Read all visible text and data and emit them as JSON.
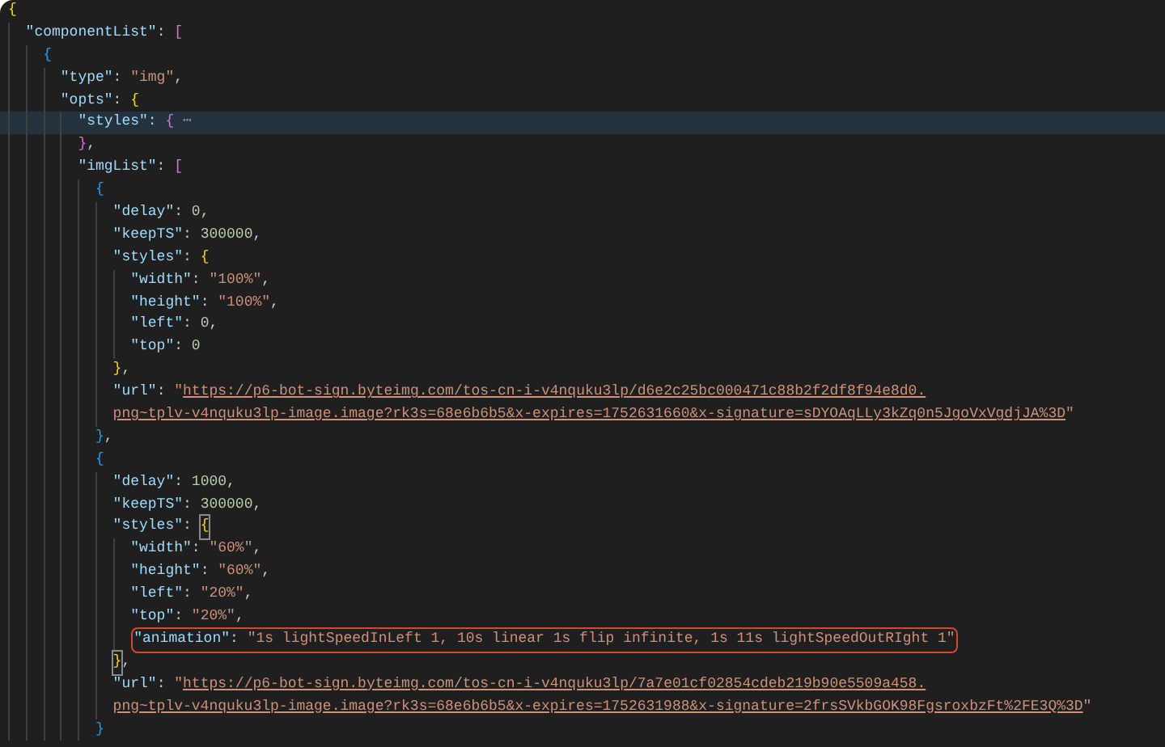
{
  "editor": {
    "lines": [
      {
        "tokens": [
          {
            "kind": "bracket",
            "text": "{",
            "color": "#ffd700"
          }
        ],
        "children": [
          {
            "tokens": [
              {
                "kind": "key",
                "text": "\"componentList\""
              },
              {
                "kind": "punct",
                "text": ": "
              },
              {
                "kind": "bracket",
                "text": "[",
                "color": "#da70d6"
              }
            ],
            "children": [
              {
                "tokens": [
                  {
                    "kind": "bracket",
                    "text": "{",
                    "color": "#179fff"
                  }
                ],
                "children": [
                  {
                    "tokens": [
                      {
                        "kind": "key",
                        "text": "\"type\""
                      },
                      {
                        "kind": "punct",
                        "text": ": "
                      },
                      {
                        "kind": "string",
                        "text": "\"img\""
                      },
                      {
                        "kind": "punct",
                        "text": ","
                      }
                    ]
                  },
                  {
                    "tokens": [
                      {
                        "kind": "key",
                        "text": "\"opts\""
                      },
                      {
                        "kind": "punct",
                        "text": ": "
                      },
                      {
                        "kind": "bracket",
                        "text": "{",
                        "color": "#ffd700"
                      }
                    ],
                    "children": [
                      {
                        "highlighted": true,
                        "tokens": [
                          {
                            "kind": "key",
                            "text": "\"styles\""
                          },
                          {
                            "kind": "punct",
                            "text": ": "
                          },
                          {
                            "kind": "bracket",
                            "text": "{",
                            "color": "#da70d6"
                          },
                          {
                            "kind": "fold",
                            "text": " ⋯"
                          }
                        ]
                      },
                      {
                        "tokens": [
                          {
                            "kind": "bracket",
                            "text": "}",
                            "color": "#da70d6"
                          },
                          {
                            "kind": "punct",
                            "text": ","
                          }
                        ]
                      },
                      {
                        "tokens": [
                          {
                            "kind": "key",
                            "text": "\"imgList\""
                          },
                          {
                            "kind": "punct",
                            "text": ": "
                          },
                          {
                            "kind": "bracket",
                            "text": "[",
                            "color": "#da70d6"
                          }
                        ],
                        "children": [
                          {
                            "tokens": [
                              {
                                "kind": "bracket",
                                "text": "{",
                                "color": "#179fff"
                              }
                            ],
                            "children": [
                              {
                                "tokens": [
                                  {
                                    "kind": "key",
                                    "text": "\"delay\""
                                  },
                                  {
                                    "kind": "punct",
                                    "text": ": "
                                  },
                                  {
                                    "kind": "number",
                                    "text": "0"
                                  },
                                  {
                                    "kind": "punct",
                                    "text": ","
                                  }
                                ]
                              },
                              {
                                "tokens": [
                                  {
                                    "kind": "key",
                                    "text": "\"keepTS\""
                                  },
                                  {
                                    "kind": "punct",
                                    "text": ": "
                                  },
                                  {
                                    "kind": "number",
                                    "text": "300000"
                                  },
                                  {
                                    "kind": "punct",
                                    "text": ","
                                  }
                                ]
                              },
                              {
                                "tokens": [
                                  {
                                    "kind": "key",
                                    "text": "\"styles\""
                                  },
                                  {
                                    "kind": "punct",
                                    "text": ": "
                                  },
                                  {
                                    "kind": "bracket",
                                    "text": "{",
                                    "color": "#ffd700"
                                  }
                                ],
                                "children": [
                                  {
                                    "tokens": [
                                      {
                                        "kind": "key",
                                        "text": "\"width\""
                                      },
                                      {
                                        "kind": "punct",
                                        "text": ": "
                                      },
                                      {
                                        "kind": "string",
                                        "text": "\"100%\""
                                      },
                                      {
                                        "kind": "punct",
                                        "text": ","
                                      }
                                    ]
                                  },
                                  {
                                    "tokens": [
                                      {
                                        "kind": "key",
                                        "text": "\"height\""
                                      },
                                      {
                                        "kind": "punct",
                                        "text": ": "
                                      },
                                      {
                                        "kind": "string",
                                        "text": "\"100%\""
                                      },
                                      {
                                        "kind": "punct",
                                        "text": ","
                                      }
                                    ]
                                  },
                                  {
                                    "tokens": [
                                      {
                                        "kind": "key",
                                        "text": "\"left\""
                                      },
                                      {
                                        "kind": "punct",
                                        "text": ": "
                                      },
                                      {
                                        "kind": "number",
                                        "text": "0"
                                      },
                                      {
                                        "kind": "punct",
                                        "text": ","
                                      }
                                    ]
                                  },
                                  {
                                    "tokens": [
                                      {
                                        "kind": "key",
                                        "text": "\"top\""
                                      },
                                      {
                                        "kind": "punct",
                                        "text": ": "
                                      },
                                      {
                                        "kind": "number",
                                        "text": "0"
                                      }
                                    ]
                                  }
                                ]
                              },
                              {
                                "tokens": [
                                  {
                                    "kind": "bracket",
                                    "text": "}",
                                    "color": "#ffd700"
                                  },
                                  {
                                    "kind": "punct",
                                    "text": ","
                                  }
                                ]
                              },
                              {
                                "tokens": [
                                  {
                                    "kind": "key",
                                    "text": "\"url\""
                                  },
                                  {
                                    "kind": "punct",
                                    "text": ": "
                                  },
                                  {
                                    "kind": "string",
                                    "text": "\""
                                  },
                                  {
                                    "kind": "link",
                                    "text": "https://p6-bot-sign.byteimg.com/tos-cn-i-v4nquku3lp/d6e2c25bc000471c88b2f2df8f94e8d0."
                                  }
                                ]
                              },
                              {
                                "tokens": [
                                  {
                                    "kind": "link",
                                    "text": "png~tplv-v4nquku3lp-image.image?rk3s=68e6b6b5&x-expires=1752631660&x-signature=sDYOAqLLy3kZq0n5JgoVxVgdjJA%3D"
                                  },
                                  {
                                    "kind": "string",
                                    "text": "\""
                                  }
                                ]
                              }
                            ]
                          },
                          {
                            "tokens": [
                              {
                                "kind": "bracket",
                                "text": "}",
                                "color": "#179fff"
                              },
                              {
                                "kind": "punct",
                                "text": ","
                              }
                            ]
                          },
                          {
                            "tokens": [
                              {
                                "kind": "bracket",
                                "text": "{",
                                "color": "#179fff"
                              }
                            ],
                            "children": [
                              {
                                "tokens": [
                                  {
                                    "kind": "key",
                                    "text": "\"delay\""
                                  },
                                  {
                                    "kind": "punct",
                                    "text": ": "
                                  },
                                  {
                                    "kind": "number",
                                    "text": "1000"
                                  },
                                  {
                                    "kind": "punct",
                                    "text": ","
                                  }
                                ]
                              },
                              {
                                "tokens": [
                                  {
                                    "kind": "key",
                                    "text": "\"keepTS\""
                                  },
                                  {
                                    "kind": "punct",
                                    "text": ": "
                                  },
                                  {
                                    "kind": "number",
                                    "text": "300000"
                                  },
                                  {
                                    "kind": "punct",
                                    "text": ","
                                  }
                                ]
                              },
                              {
                                "tokens": [
                                  {
                                    "kind": "key",
                                    "text": "\"styles\""
                                  },
                                  {
                                    "kind": "punct",
                                    "text": ": "
                                  },
                                  {
                                    "kind": "bracket",
                                    "text": "{",
                                    "color": "#ffd700",
                                    "matched": true
                                  }
                                ],
                                "children": [
                                  {
                                    "tokens": [
                                      {
                                        "kind": "key",
                                        "text": "\"width\""
                                      },
                                      {
                                        "kind": "punct",
                                        "text": ": "
                                      },
                                      {
                                        "kind": "string",
                                        "text": "\"60%\""
                                      },
                                      {
                                        "kind": "punct",
                                        "text": ","
                                      }
                                    ]
                                  },
                                  {
                                    "tokens": [
                                      {
                                        "kind": "key",
                                        "text": "\"height\""
                                      },
                                      {
                                        "kind": "punct",
                                        "text": ": "
                                      },
                                      {
                                        "kind": "string",
                                        "text": "\"60%\""
                                      },
                                      {
                                        "kind": "punct",
                                        "text": ","
                                      }
                                    ]
                                  },
                                  {
                                    "tokens": [
                                      {
                                        "kind": "key",
                                        "text": "\"left\""
                                      },
                                      {
                                        "kind": "punct",
                                        "text": ": "
                                      },
                                      {
                                        "kind": "string",
                                        "text": "\"20%\""
                                      },
                                      {
                                        "kind": "punct",
                                        "text": ","
                                      }
                                    ]
                                  },
                                  {
                                    "tokens": [
                                      {
                                        "kind": "key",
                                        "text": "\"top\""
                                      },
                                      {
                                        "kind": "punct",
                                        "text": ": "
                                      },
                                      {
                                        "kind": "string",
                                        "text": "\"20%\""
                                      },
                                      {
                                        "kind": "punct",
                                        "text": ","
                                      }
                                    ]
                                  },
                                  {
                                    "boxed": true,
                                    "tokens": [
                                      {
                                        "kind": "key",
                                        "text": "\"animation\""
                                      },
                                      {
                                        "kind": "punct",
                                        "text": ": "
                                      },
                                      {
                                        "kind": "string",
                                        "text": "\"1s lightSpeedInLeft 1, 10s linear 1s flip infinite, 1s 11s lightSpeedOutRIght 1\""
                                      }
                                    ]
                                  }
                                ]
                              },
                              {
                                "tokens": [
                                  {
                                    "kind": "bracket",
                                    "text": "}",
                                    "color": "#ffd700",
                                    "matched": true
                                  },
                                  {
                                    "kind": "punct",
                                    "text": ","
                                  }
                                ]
                              },
                              {
                                "tokens": [
                                  {
                                    "kind": "key",
                                    "text": "\"url\""
                                  },
                                  {
                                    "kind": "punct",
                                    "text": ": "
                                  },
                                  {
                                    "kind": "string",
                                    "text": "\""
                                  },
                                  {
                                    "kind": "link",
                                    "text": "https://p6-bot-sign.byteimg.com/tos-cn-i-v4nquku3lp/7a7e01cf02854cdeb219b90e5509a458."
                                  }
                                ]
                              },
                              {
                                "tokens": [
                                  {
                                    "kind": "link",
                                    "text": "png~tplv-v4nquku3lp-image.image?rk3s=68e6b6b5&x-expires=1752631988&x-signature=2frsSVkbGOK98FgsroxbzFt%2FE3Q%3D"
                                  },
                                  {
                                    "kind": "string",
                                    "text": "\""
                                  }
                                ]
                              }
                            ]
                          },
                          {
                            "tokens": [
                              {
                                "kind": "bracket",
                                "text": "}",
                                "color": "#179fff"
                              }
                            ]
                          }
                        ]
                      }
                    ]
                  }
                ]
              }
            ]
          }
        ]
      }
    ]
  }
}
